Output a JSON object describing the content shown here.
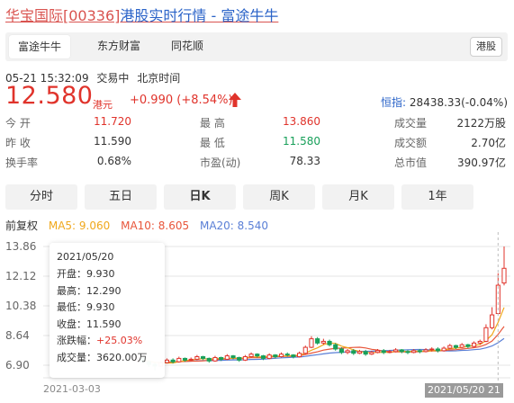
{
  "title": {
    "stock": "华宝国际[00336]",
    "rest": "港股实时行情 - 富途牛牛"
  },
  "source_tabs": [
    {
      "label": "富途牛牛",
      "active": true
    },
    {
      "label": "东方财富",
      "active": false
    },
    {
      "label": "同花顺",
      "active": false
    }
  ],
  "market_badge": "港股",
  "status": {
    "time": "05-21 15:32:09",
    "state": "交易中",
    "timezone": "北京时间"
  },
  "price": {
    "last": "12.580",
    "currency": "港元",
    "change": "+0.990 (+8.54%)",
    "index_label": "恒指:",
    "index_value": "28438.33(-0.04%)"
  },
  "quote": {
    "open_label": "今  开",
    "open": "11.720",
    "prev_close_label": "昨  收",
    "prev_close": "11.590",
    "turnover_rate_label": "换手率",
    "turnover_rate": "0.68%",
    "high_label": "最  高",
    "high": "13.860",
    "low_label": "最  低",
    "low": "11.580",
    "pe_label": "市盈(动)",
    "pe": "78.33",
    "volume_label": "成交量",
    "volume": "2122万股",
    "amount_label": "成交额",
    "amount": "2.70亿",
    "mkt_cap_label": "总市值",
    "mkt_cap": "390.97亿"
  },
  "period_tabs": [
    {
      "label": "分时",
      "active": false
    },
    {
      "label": "五日",
      "active": false
    },
    {
      "label": "日K",
      "active": true
    },
    {
      "label": "周K",
      "active": false
    },
    {
      "label": "月K",
      "active": false
    },
    {
      "label": "1年",
      "active": false
    }
  ],
  "ma_legend": {
    "adjust": "前复权",
    "ma5": "MA5: 9.060",
    "ma10": "MA10: 8.605",
    "ma20": "MA20: 8.540"
  },
  "colors": {
    "up": "#e0332b",
    "down": "#18a05a",
    "ma5": "#f0a81c",
    "ma10": "#e8553a",
    "ma20": "#5a7fd6",
    "link": "#2a63c8"
  },
  "tooltip": {
    "date": "2021/05/20",
    "open": "开盘：9.930",
    "high": "最高：12.290",
    "low": "最低：9.930",
    "close": "收盘：11.590",
    "change_label": "涨跌幅：",
    "change_value": "+25.03%",
    "volume": "成交量：3620.00万"
  },
  "chart_data": {
    "type": "candlestick",
    "y_ticks": [
      "13.86",
      "12.12",
      "10.38",
      "8.64",
      "6.90"
    ],
    "ylim": [
      6.9,
      13.86
    ],
    "x_start_label": "2021-03-03",
    "x_end_label": "2021/05/20",
    "x_end_suffix": "21",
    "candles": [
      [
        7.15,
        7.35,
        7.05,
        7.4
      ],
      [
        7.3,
        7.1,
        7.05,
        7.4
      ],
      [
        7.1,
        6.95,
        6.8,
        7.2
      ],
      [
        6.95,
        6.85,
        6.6,
        7.05
      ],
      [
        6.85,
        7.05,
        6.8,
        7.15
      ],
      [
        7.05,
        7.2,
        7.0,
        7.3
      ],
      [
        7.2,
        7.1,
        7.0,
        7.3
      ],
      [
        7.1,
        7.3,
        7.05,
        7.4
      ],
      [
        7.3,
        7.2,
        7.1,
        7.35
      ],
      [
        7.2,
        7.25,
        7.15,
        7.35
      ],
      [
        7.25,
        7.4,
        7.2,
        7.5
      ],
      [
        7.4,
        7.3,
        7.2,
        7.45
      ],
      [
        7.3,
        7.15,
        7.05,
        7.35
      ],
      [
        7.15,
        7.35,
        7.1,
        7.45
      ],
      [
        7.35,
        7.25,
        7.15,
        7.4
      ],
      [
        7.25,
        7.45,
        7.2,
        7.55
      ],
      [
        7.45,
        7.35,
        7.25,
        7.5
      ],
      [
        7.35,
        7.2,
        7.1,
        7.4
      ],
      [
        7.2,
        7.4,
        7.15,
        7.5
      ],
      [
        7.4,
        7.55,
        7.35,
        7.65
      ],
      [
        7.55,
        7.45,
        7.35,
        7.6
      ],
      [
        7.45,
        7.3,
        7.2,
        7.5
      ],
      [
        7.3,
        7.5,
        7.25,
        7.6
      ],
      [
        7.5,
        7.4,
        7.3,
        7.55
      ],
      [
        7.4,
        7.55,
        7.35,
        7.65
      ],
      [
        7.55,
        7.5,
        7.4,
        7.65
      ],
      [
        7.5,
        7.4,
        7.3,
        7.55
      ],
      [
        7.4,
        7.6,
        7.35,
        7.7
      ],
      [
        7.6,
        7.95,
        7.55,
        8.05
      ],
      [
        7.95,
        8.45,
        7.9,
        8.6
      ],
      [
        8.45,
        8.2,
        8.1,
        8.55
      ],
      [
        8.2,
        8.3,
        8.1,
        8.45
      ],
      [
        8.3,
        8.1,
        8.0,
        8.4
      ],
      [
        8.1,
        7.85,
        7.75,
        8.2
      ],
      [
        7.85,
        7.65,
        7.55,
        7.95
      ],
      [
        7.65,
        7.75,
        7.55,
        7.85
      ],
      [
        7.75,
        7.6,
        7.5,
        7.85
      ],
      [
        7.6,
        7.7,
        7.55,
        7.8
      ],
      [
        7.7,
        7.55,
        7.45,
        7.8
      ],
      [
        7.55,
        7.65,
        7.5,
        7.75
      ],
      [
        7.65,
        7.75,
        7.6,
        7.85
      ],
      [
        7.75,
        7.65,
        7.55,
        7.85
      ],
      [
        7.65,
        7.7,
        7.6,
        7.8
      ],
      [
        7.7,
        7.8,
        7.65,
        7.9
      ],
      [
        7.8,
        7.7,
        7.6,
        7.85
      ],
      [
        7.7,
        7.65,
        7.55,
        7.8
      ],
      [
        7.65,
        7.75,
        7.6,
        7.85
      ],
      [
        7.75,
        7.7,
        7.6,
        7.85
      ],
      [
        7.7,
        7.8,
        7.65,
        7.9
      ],
      [
        7.8,
        7.85,
        7.7,
        7.95
      ],
      [
        7.85,
        7.75,
        7.65,
        7.95
      ],
      [
        7.75,
        7.9,
        7.7,
        8.0
      ],
      [
        7.9,
        8.05,
        7.85,
        8.15
      ],
      [
        8.05,
        7.95,
        7.85,
        8.1
      ],
      [
        7.95,
        8.1,
        7.9,
        8.2
      ],
      [
        8.1,
        8.0,
        7.9,
        8.15
      ],
      [
        8.0,
        8.2,
        7.95,
        8.3
      ],
      [
        8.2,
        8.3,
        8.1,
        8.4
      ],
      [
        8.3,
        9.1,
        8.25,
        9.3
      ],
      [
        9.1,
        9.85,
        9.0,
        10.3
      ],
      [
        9.93,
        11.59,
        9.93,
        12.29
      ],
      [
        11.72,
        12.58,
        11.58,
        13.86
      ]
    ]
  }
}
